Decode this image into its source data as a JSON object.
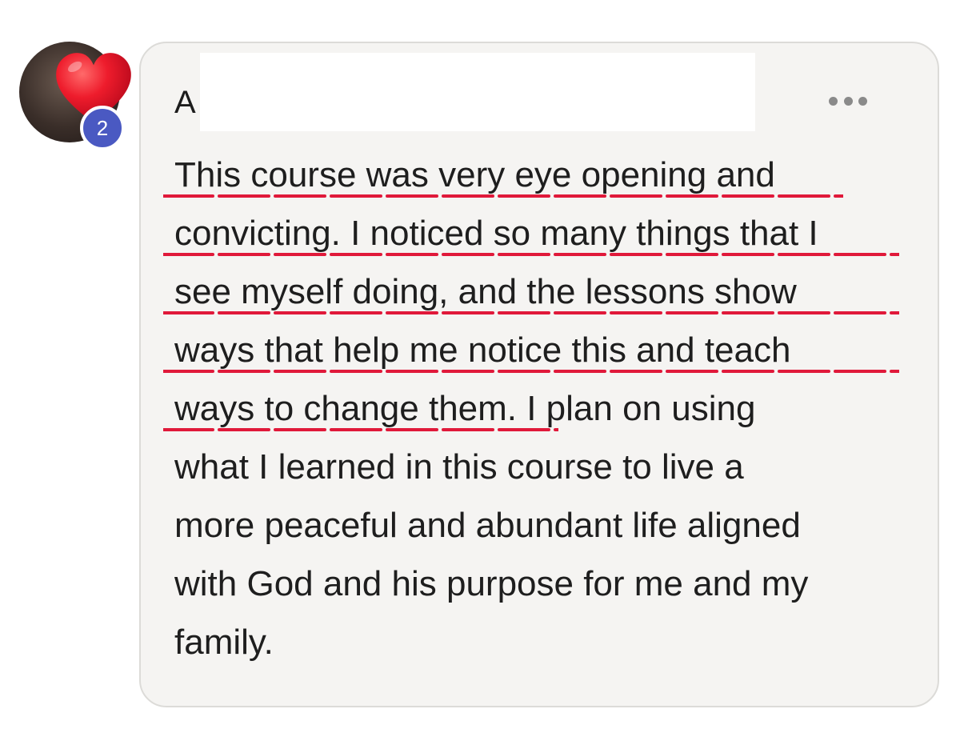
{
  "avatar": {
    "icon": "heart-icon",
    "reaction_count": "2",
    "heart_color": "#e8102a",
    "badge_color": "#4a59c2"
  },
  "post": {
    "author_initial": "A",
    "more_icon": "more-horizontal-icon",
    "underline_color": "#e0193a",
    "lines": [
      "This course was very eye opening and",
      "convicting. I noticed so many things that I",
      "see myself doing, and the lessons show",
      "ways that help me notice this and teach",
      "ways to change them. I plan on using",
      "what I learned in this course to live a",
      "more peaceful and abundant life aligned",
      "with God and his purpose for me and my",
      "family."
    ]
  }
}
